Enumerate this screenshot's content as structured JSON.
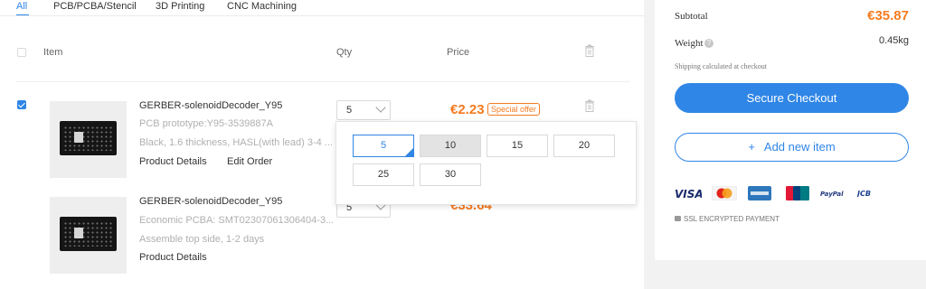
{
  "tabs": [
    "All",
    "PCB/PCBA/Stencil",
    "3D Printing",
    "CNC Machining"
  ],
  "header": {
    "item": "Item",
    "qty": "Qty",
    "price": "Price"
  },
  "items": [
    {
      "checked": true,
      "name": "GERBER-solenoidDecoder_Y95",
      "line1": "PCB prototype:Y95-3539887A",
      "line2": "Black, 1.6 thickness, HASL(with lead) 3-4 ...",
      "links": [
        "Product Details",
        "Edit Order"
      ],
      "qty": "5",
      "price": "€2.23",
      "badge": "Special offer"
    },
    {
      "checked": false,
      "name": "GERBER-solenoidDecoder_Y95",
      "line1": "Economic PCBA: SMT02307061306404-3...",
      "line2": "Assemble top side, 1-2 days",
      "links": [
        "Product Details"
      ],
      "qty": "5",
      "price": "€33.64"
    }
  ],
  "qty_dropdown": {
    "options": [
      "5",
      "10",
      "15",
      "20",
      "25",
      "30"
    ],
    "selected": "5",
    "hovered": "10"
  },
  "summary": {
    "subtotal_label": "Subtotal",
    "subtotal": "€35.87",
    "weight_label": "Weight",
    "weight": "0.45kg",
    "shipping_note": "Shipping calculated at checkout",
    "checkout_button": "Secure Checkout",
    "add_item_button": "Add new item",
    "add_icon": "+",
    "payment_methods": [
      "VISA",
      "Maestro",
      "American Express",
      "UnionPay",
      "PayPal",
      "JCB"
    ],
    "ssl_text": "SSL ENCRYPTED PAYMENT"
  },
  "colors": {
    "accent": "#2f86e6",
    "price": "#f47b20"
  }
}
